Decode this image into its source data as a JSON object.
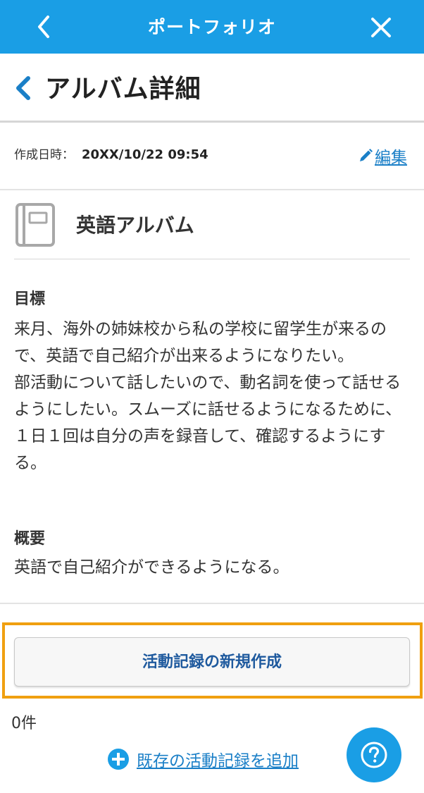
{
  "topbar": {
    "title": "ポートフォリオ",
    "back_icon": "chevron-left-icon",
    "close_icon": "close-icon"
  },
  "page": {
    "heading": "アルバム詳細",
    "back_icon": "chevron-left-icon"
  },
  "meta": {
    "created_label": "作成日時：",
    "created_value": "20XX/10/22 09:54",
    "edit_label": "編集",
    "edit_icon": "pencil-icon"
  },
  "album": {
    "icon": "album-icon",
    "name": "英語アルバム"
  },
  "goal": {
    "title": "目標",
    "text": "来月、海外の姉妹校から私の学校に留学生が来るので、英語で自己紹介が出来るようになりたい。\n部活動について話したいので、動名詞を使って話せるようにしたい。スムーズに話せるようになるために、１日１回は自分の声を録音して、確認するようにする。"
  },
  "summary": {
    "title": "概要",
    "text": "英語で自己紹介ができるようになる。"
  },
  "actions": {
    "create_label": "活動記録の新規作成",
    "count_label": "0件",
    "add_existing_label": "既存の活動記録を追加",
    "add_icon": "plus-circle-icon"
  },
  "help": {
    "icon": "help-icon"
  },
  "colors": {
    "header_bg": "#1a9ee5",
    "link": "#1a7fc7",
    "highlight": "#f0a010",
    "button_text": "#1f5a9e"
  }
}
